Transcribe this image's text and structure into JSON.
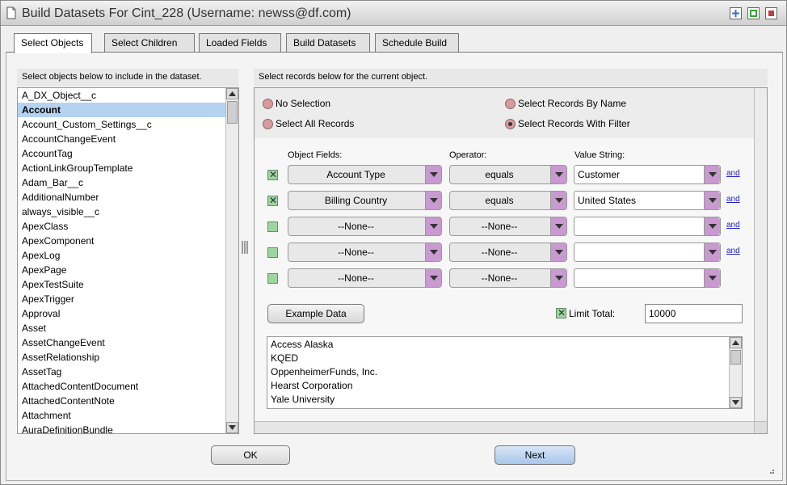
{
  "window": {
    "title": "Build Datasets For Cint_228 (Username: newss@df.com)",
    "icons": [
      "document-icon",
      "add-icon",
      "restore-icon",
      "close-icon"
    ],
    "colors": {
      "add": "#3b6fc4",
      "restore": "#3aa23a",
      "close": "#c43b3b"
    }
  },
  "tabs": [
    {
      "label": "Select Objects",
      "active": true
    },
    {
      "label": "Select Children",
      "active": false
    },
    {
      "label": "Loaded Fields",
      "active": false
    },
    {
      "label": "Build Datasets",
      "active": false
    },
    {
      "label": "Schedule Build",
      "active": false
    }
  ],
  "left_panel": {
    "header": "Select objects below to include in the dataset.",
    "selected": "Account",
    "items": [
      "A_DX_Object__c",
      "Account",
      "Account_Custom_Settings__c",
      "AccountChangeEvent",
      "AccountTag",
      "ActionLinkGroupTemplate",
      "Adam_Bar__c",
      "AdditionalNumber",
      "always_visible__c",
      "ApexClass",
      "ApexComponent",
      "ApexLog",
      "ApexPage",
      "ApexTestSuite",
      "ApexTrigger",
      "Approval",
      "Asset",
      "AssetChangeEvent",
      "AssetRelationship",
      "AssetTag",
      "AttachedContentDocument",
      "AttachedContentNote",
      "Attachment",
      "AuraDefinitionBundle"
    ]
  },
  "right_panel": {
    "header": "Select records below for the current object.",
    "radios": {
      "no_selection": "No Selection",
      "select_all": "Select All Records",
      "by_name": "Select Records By Name",
      "with_filter": "Select Records With Filter",
      "selected": "with_filter"
    },
    "columns": {
      "fields": "Object Fields:",
      "operator": "Operator:",
      "value": "Value String:"
    },
    "filters": [
      {
        "checked": true,
        "field": "Account Type",
        "operator": "equals",
        "value": "Customer",
        "conj": "and"
      },
      {
        "checked": true,
        "field": "Billing Country",
        "operator": "equals",
        "value": "United States",
        "conj": "and"
      },
      {
        "checked": false,
        "field": "--None--",
        "operator": "--None--",
        "value": "",
        "conj": "and"
      },
      {
        "checked": false,
        "field": "--None--",
        "operator": "--None--",
        "value": "",
        "conj": "and"
      },
      {
        "checked": false,
        "field": "--None--",
        "operator": "--None--",
        "value": "",
        "conj": ""
      }
    ],
    "example_button": "Example Data",
    "limit": {
      "checked": true,
      "label": "Limit Total:",
      "value": "10000"
    },
    "results": [
      "Access Alaska",
      "KQED",
      "OppenheimerFunds, Inc.",
      "Hearst Corporation",
      "Yale University"
    ]
  },
  "footer": {
    "ok": "OK",
    "next": "Next"
  }
}
